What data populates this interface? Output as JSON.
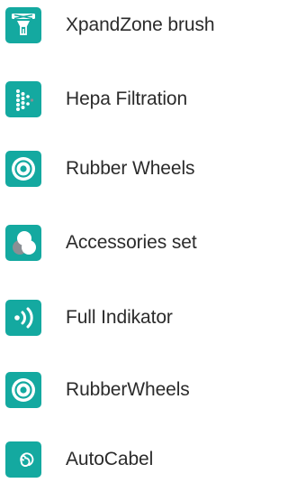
{
  "features": [
    {
      "label": "XpandZone brush",
      "icon": "brush-icon"
    },
    {
      "label": "Hepa Filtration",
      "icon": "filter-dots-icon"
    },
    {
      "label": "Rubber Wheels",
      "icon": "wheel-icon"
    },
    {
      "label": "Accessories set",
      "icon": "accessories-icon"
    },
    {
      "label": "Full Indikator",
      "icon": "signal-indicator-icon"
    },
    {
      "label": "RubberWheels",
      "icon": "wheel-icon"
    },
    {
      "label": "AutoCabel",
      "icon": "cable-rewind-icon"
    }
  ],
  "colors": {
    "icon_background": "#14a9a0",
    "icon_glyph": "#ffffff",
    "accent_grey": "#8a8f94",
    "text": "#2b2b2b"
  }
}
